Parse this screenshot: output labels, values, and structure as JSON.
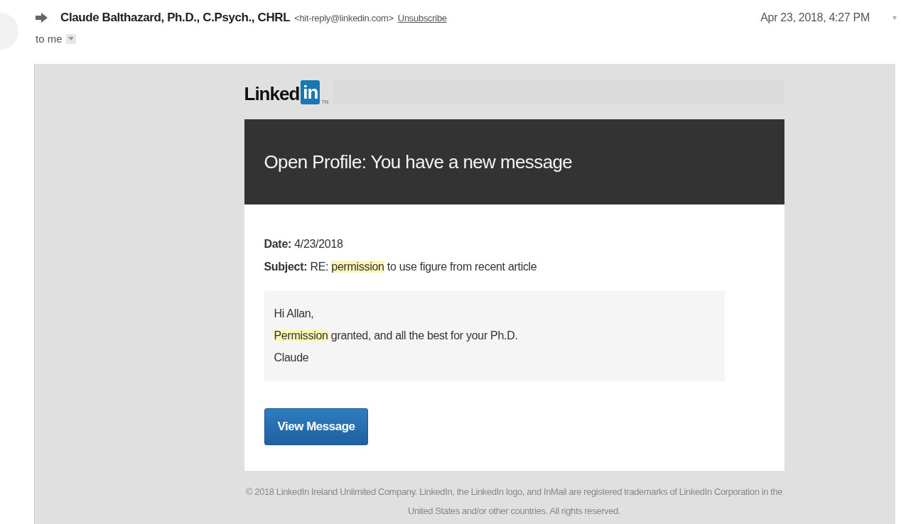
{
  "email_header": {
    "sender_name": "Claude Balthazard, Ph.D., C.Psych., CHRL",
    "sender_address": "<hit-reply@linkedin.com>",
    "unsubscribe": "Unsubscribe",
    "date": "Apr 23, 2018, 4:27 PM",
    "recipient": "to me"
  },
  "email_body": {
    "logo": {
      "word": "Linked",
      "badge": "in",
      "mark": "TM"
    },
    "banner_title": "Open Profile: You have a new message",
    "fields": [
      {
        "label": "Date:",
        "parts": [
          {
            "text": "4/23/2018",
            "highlight": false
          }
        ]
      },
      {
        "label": "Subject:",
        "parts": [
          {
            "text": "RE: ",
            "highlight": false
          },
          {
            "text": "permission",
            "highlight": true
          },
          {
            "text": " to use figure from recent article",
            "highlight": false
          }
        ]
      }
    ],
    "message_lines": [
      [
        {
          "text": "Hi Allan,",
          "highlight": false
        }
      ],
      [
        {
          "text": "Permission",
          "highlight": true
        },
        {
          "text": " granted, and all the best for your Ph.D.",
          "highlight": false
        }
      ],
      [
        {
          "text": "Claude",
          "highlight": false
        }
      ]
    ],
    "button": "View Message",
    "footer": "© 2018 LinkedIn Ireland Unlimited Company. LinkedIn, the LinkedIn logo, and InMail are registered trademarks of LinkedIn Corporation in the United States and/or other countries. All rights reserved."
  }
}
